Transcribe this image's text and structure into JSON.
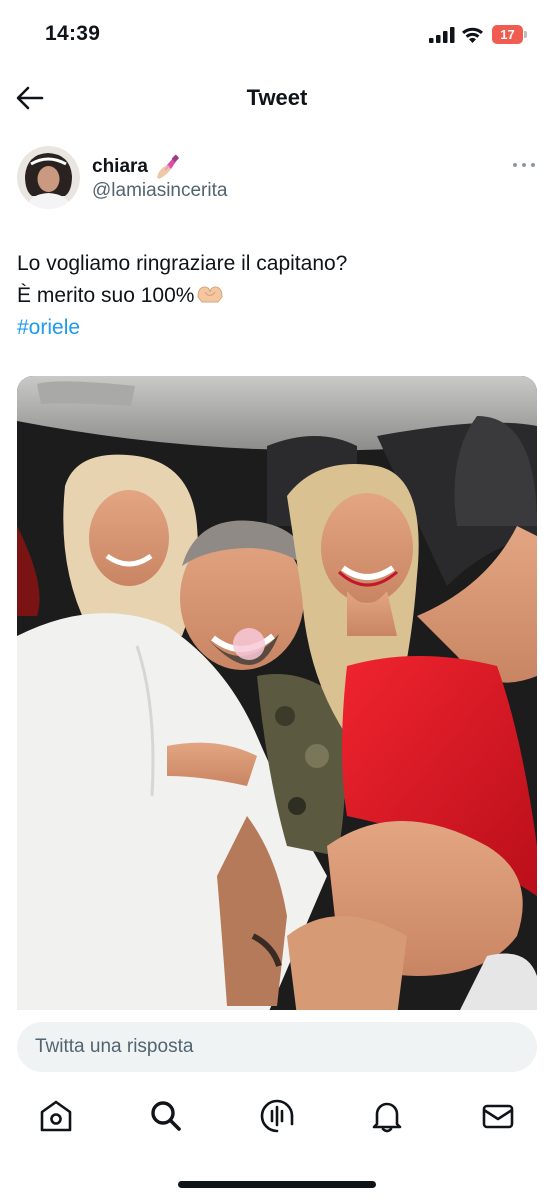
{
  "status_bar": {
    "time": "14:39",
    "battery_level": "17",
    "battery_color": "#f05c4f"
  },
  "nav": {
    "title": "Tweet",
    "back_icon": "arrow-left-icon"
  },
  "tweet": {
    "author_name": "chiara",
    "author_emoji": "nail-polish-icon",
    "author_handle": "@lamiasincerita",
    "lines": [
      "Lo vogliamo ringraziare il capitano?",
      "È merito suo 100%"
    ],
    "line2_emoji": "heart-hands-icon",
    "hashtag": "#oriele",
    "hashtag_color": "#1d9bf0",
    "media_description": "photo"
  },
  "reply": {
    "placeholder": "Twitta una risposta"
  },
  "tabbar": {
    "items": [
      {
        "icon": "home-icon"
      },
      {
        "icon": "search-icon"
      },
      {
        "icon": "spaces-icon"
      },
      {
        "icon": "bell-icon"
      },
      {
        "icon": "mail-icon"
      }
    ]
  }
}
